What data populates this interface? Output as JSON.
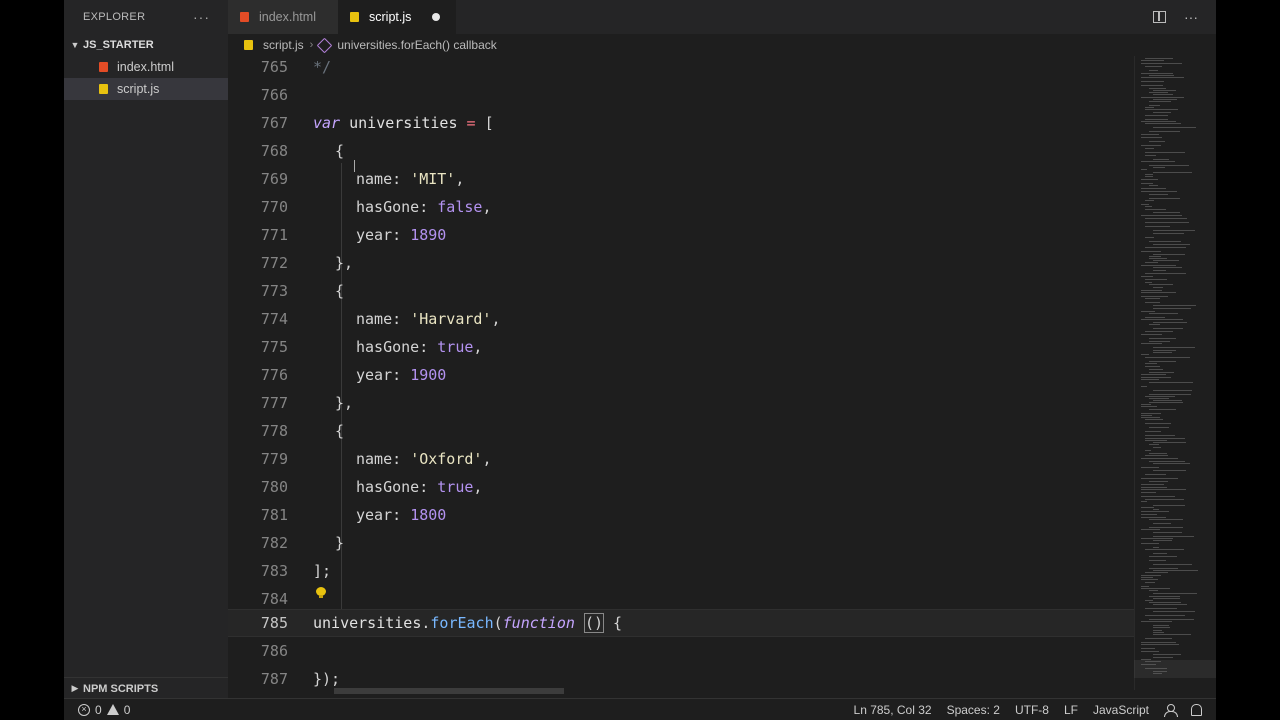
{
  "sidebar": {
    "title": "EXPLORER",
    "more": "···",
    "folder": "JS_STARTER",
    "files": [
      {
        "name": "index.html",
        "type": "html",
        "active": false
      },
      {
        "name": "script.js",
        "type": "js",
        "active": true
      }
    ],
    "npm_section": "NPM SCRIPTS"
  },
  "tabs": [
    {
      "label": "index.html",
      "type": "html",
      "active": false
    },
    {
      "label": "script.js",
      "type": "js",
      "active": true,
      "dirty": true
    }
  ],
  "tab_actions": {
    "more": "···"
  },
  "breadcrumb": {
    "file": "script.js",
    "symbol": "universities.forEach() callback"
  },
  "editor": {
    "lines": [
      {
        "num": "765",
        "text": "*/"
      },
      {
        "num": "766",
        "text": ""
      },
      {
        "num": "767",
        "text": "var universities = ["
      },
      {
        "num": "768",
        "text": "{"
      },
      {
        "num": "769",
        "text": "name: 'MIT',"
      },
      {
        "num": "770",
        "text": "hasGone: false,"
      },
      {
        "num": "771",
        "text": "year: 1890"
      },
      {
        "num": "772",
        "text": "},"
      },
      {
        "num": "773",
        "text": "{"
      },
      {
        "num": "774",
        "text": "name: 'Harvard',"
      },
      {
        "num": "775",
        "text": "hasGone: true,"
      },
      {
        "num": "776",
        "text": "year: 1900"
      },
      {
        "num": "777",
        "text": "},"
      },
      {
        "num": "778",
        "text": "{"
      },
      {
        "num": "779",
        "text": "name: 'Oxford',"
      },
      {
        "num": "780",
        "text": "hasGone: true,"
      },
      {
        "num": "781",
        "text": "year: 1800"
      },
      {
        "num": "782",
        "text": "}"
      },
      {
        "num": "783",
        "text": "];"
      },
      {
        "num": "784",
        "text": ""
      },
      {
        "num": "785",
        "text": "universities.forEach(function () {"
      },
      {
        "num": "786",
        "text": ""
      },
      {
        "num": "787",
        "text": "});"
      }
    ],
    "current_line": "785"
  },
  "statusbar": {
    "errors": "0",
    "warnings": "0",
    "position": "Ln 785, Col 32",
    "spaces": "Spaces: 2",
    "encoding": "UTF-8",
    "eol": "LF",
    "language": "JavaScript"
  },
  "colors": {
    "keyword": "#c5a5ff",
    "string": "#e9e4c2",
    "number": "#b392f0",
    "function": "#79b8ff",
    "operator": "#f97583"
  }
}
